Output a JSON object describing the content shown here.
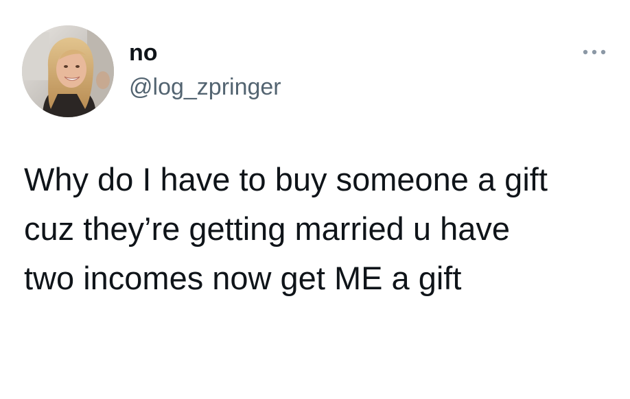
{
  "user": {
    "display_name": "no",
    "handle": "@log_zpringer",
    "avatar_icon": "profile-photo"
  },
  "actions": {
    "more_icon": "more-horizontal-icon"
  },
  "tweet": {
    "lines": [
      "Why do I have to buy someone a gift",
      "cuz they’re getting married u have",
      "two incomes now get ME a gift"
    ]
  },
  "colors": {
    "text_primary": "#0f1419",
    "text_secondary": "#536471",
    "background": "#ffffff"
  }
}
